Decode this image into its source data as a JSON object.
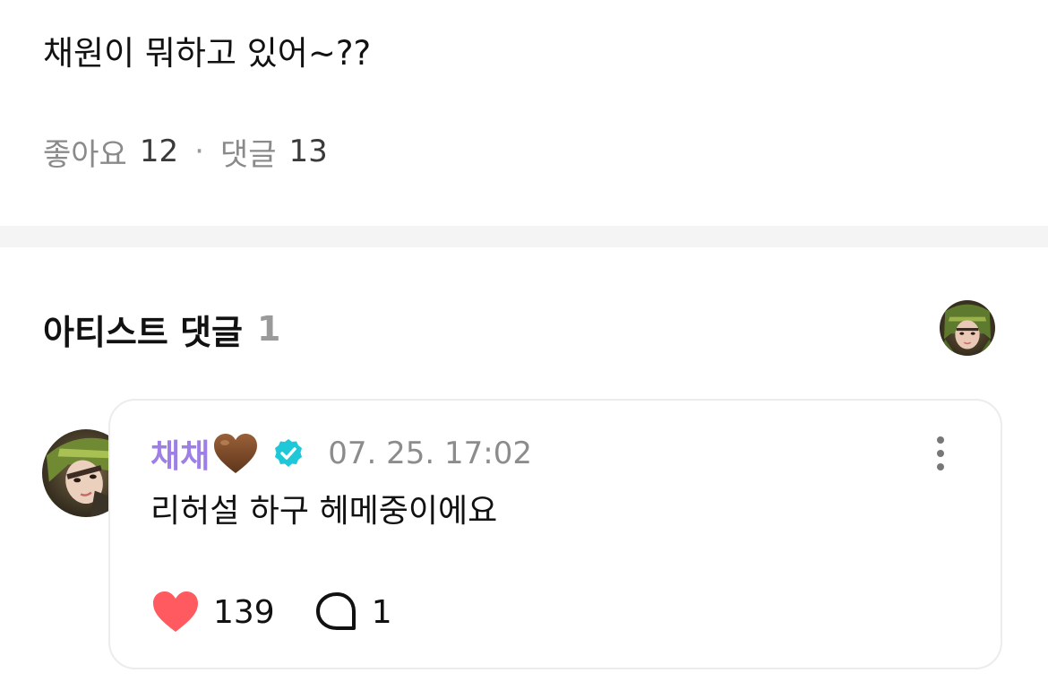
{
  "post": {
    "text": "채원이 뭐하고 있어~??",
    "likes_label": "좋아요",
    "likes_count": "12",
    "separator": "·",
    "comments_label": "댓글",
    "comments_count": "13"
  },
  "artist_comments": {
    "title": "아티스트 댓글",
    "count": "1",
    "header_avatar_icon": "artist-avatar"
  },
  "comment": {
    "author": "채채",
    "author_emoji": "brown-heart-icon",
    "verified_icon": "verified-badge-icon",
    "timestamp": "07. 25. 17:02",
    "body": "리허설 하구 헤메중이에요",
    "likes": "139",
    "replies": "1",
    "more_icon": "more-vertical-icon",
    "colors": {
      "author": "#9d7fe6",
      "like_heart": "#ff5a5f",
      "verified": "#1ec8d8"
    }
  }
}
